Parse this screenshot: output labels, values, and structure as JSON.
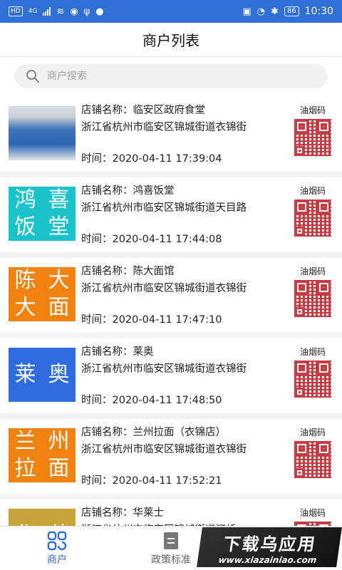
{
  "status_bar": {
    "left_badge": "HD",
    "network": "4G",
    "battery": "86",
    "time": "10:30"
  },
  "title": "商户列表",
  "search": {
    "placeholder": "商户搜索"
  },
  "list": {
    "qr_label": "油烟码",
    "name_prefix": "店铺名称：",
    "time_prefix": "时间：",
    "items": [
      {
        "name": "临安区政府食堂",
        "address": "浙江省杭州市临安区锦城街道衣锦街",
        "time": "2020-04-11 17:39:04",
        "thumb_type": "photo",
        "thumb_chars": [],
        "thumb_color": ""
      },
      {
        "name": "鸿喜饭堂",
        "address": "浙江省杭州市临安区锦城街道天目路",
        "time": "2020-04-11 17:44:08",
        "thumb_type": "text",
        "thumb_chars": [
          "鸿",
          "喜",
          "饭",
          "堂"
        ],
        "thumb_color": "#19c3c9"
      },
      {
        "name": "陈大面馆",
        "address": "浙江省杭州市临安区锦城街道衣锦街",
        "time": "2020-04-11 17:47:10",
        "thumb_type": "text",
        "thumb_chars": [
          "陈",
          "大",
          "大",
          "面"
        ],
        "thumb_color": "#f0820f"
      },
      {
        "name": "莱奥",
        "address": "浙江省杭州市临安区锦城街道衣锦街",
        "time": "2020-04-11 17:48:50",
        "thumb_type": "text",
        "thumb_chars": [
          "莱",
          "奥"
        ],
        "thumb_color": "#2f6ce0"
      },
      {
        "name": "兰州拉面（衣锦店）",
        "address": "浙江省杭州市临安区锦城街道衣锦街",
        "time": "2020-04-11 17:52:21",
        "thumb_type": "text",
        "thumb_chars": [
          "兰",
          "州",
          "拉",
          "面"
        ],
        "thumb_color": "#f0820f"
      },
      {
        "name": "华莱士",
        "address": "浙江省杭州市临安区锦城街道汀桥",
        "time": "",
        "thumb_type": "text",
        "thumb_chars": [
          "华",
          "莱"
        ],
        "thumb_color": "#c8a43a"
      }
    ]
  },
  "tabbar": {
    "tabs": [
      {
        "label": "商户",
        "icon": "grid-icon",
        "active": true
      },
      {
        "label": "政策标准",
        "icon": "document-icon",
        "active": false
      }
    ]
  },
  "watermark": {
    "line1": "下载乌应用",
    "line2": "www.xiazainiao.com"
  },
  "colors": {
    "accent": "#2f6fd6",
    "qr": "#c2262e"
  }
}
